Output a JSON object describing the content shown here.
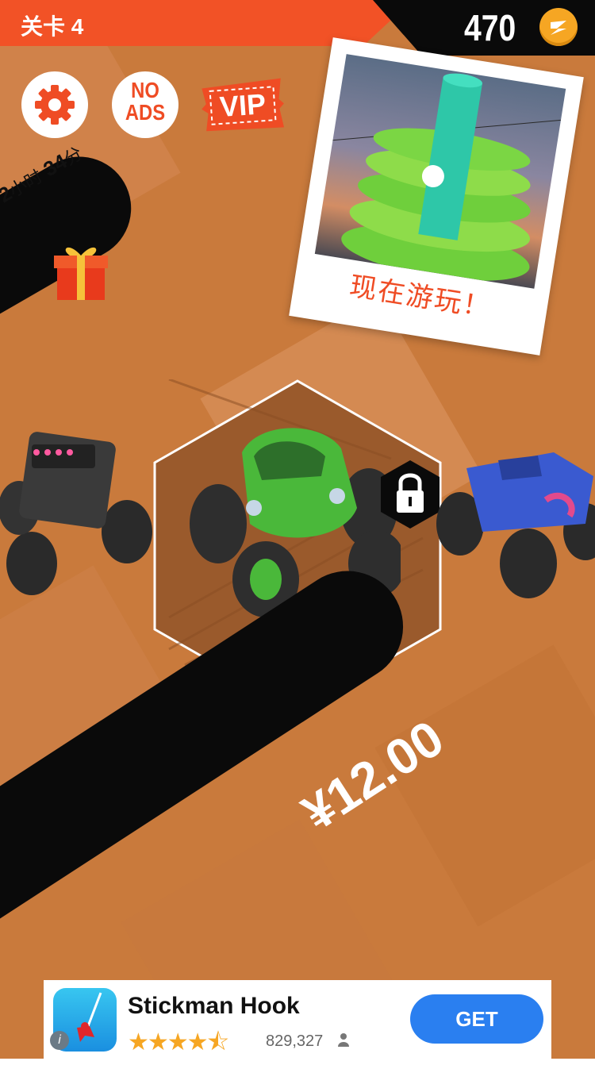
{
  "header": {
    "level_label": "关卡 4",
    "coin_count": "470",
    "coin_icon": "lightning-coin-icon"
  },
  "buttons": {
    "settings_icon": "gear-icon",
    "no_ads_line1": "NO",
    "no_ads_line2": "ADS",
    "vip_label": "VIP"
  },
  "reward": {
    "timer_hours": "2",
    "timer_hours_unit": "小时",
    "timer_minutes": "34",
    "timer_minutes_unit": "分",
    "gift_icon": "gift-box-icon"
  },
  "promo": {
    "cta_text": "现在游玩！"
  },
  "garage": {
    "price": "¥12.00",
    "lock_icon": "padlock-icon",
    "colors": {
      "selected_car": "#4ab83a",
      "left_car": "#3a3a3a",
      "right_car": "#3a5ad0"
    }
  },
  "ad_banner": {
    "title": "Stickman Hook",
    "rating_stars": "★★★★⯪",
    "rating_count": "829,327",
    "get_label": "GET",
    "info_label": "i"
  },
  "colors": {
    "accent_red": "#f25226",
    "coin_gold": "#f6a623",
    "background_wood": "#c97a3c",
    "get_button": "#2a7ff0"
  }
}
